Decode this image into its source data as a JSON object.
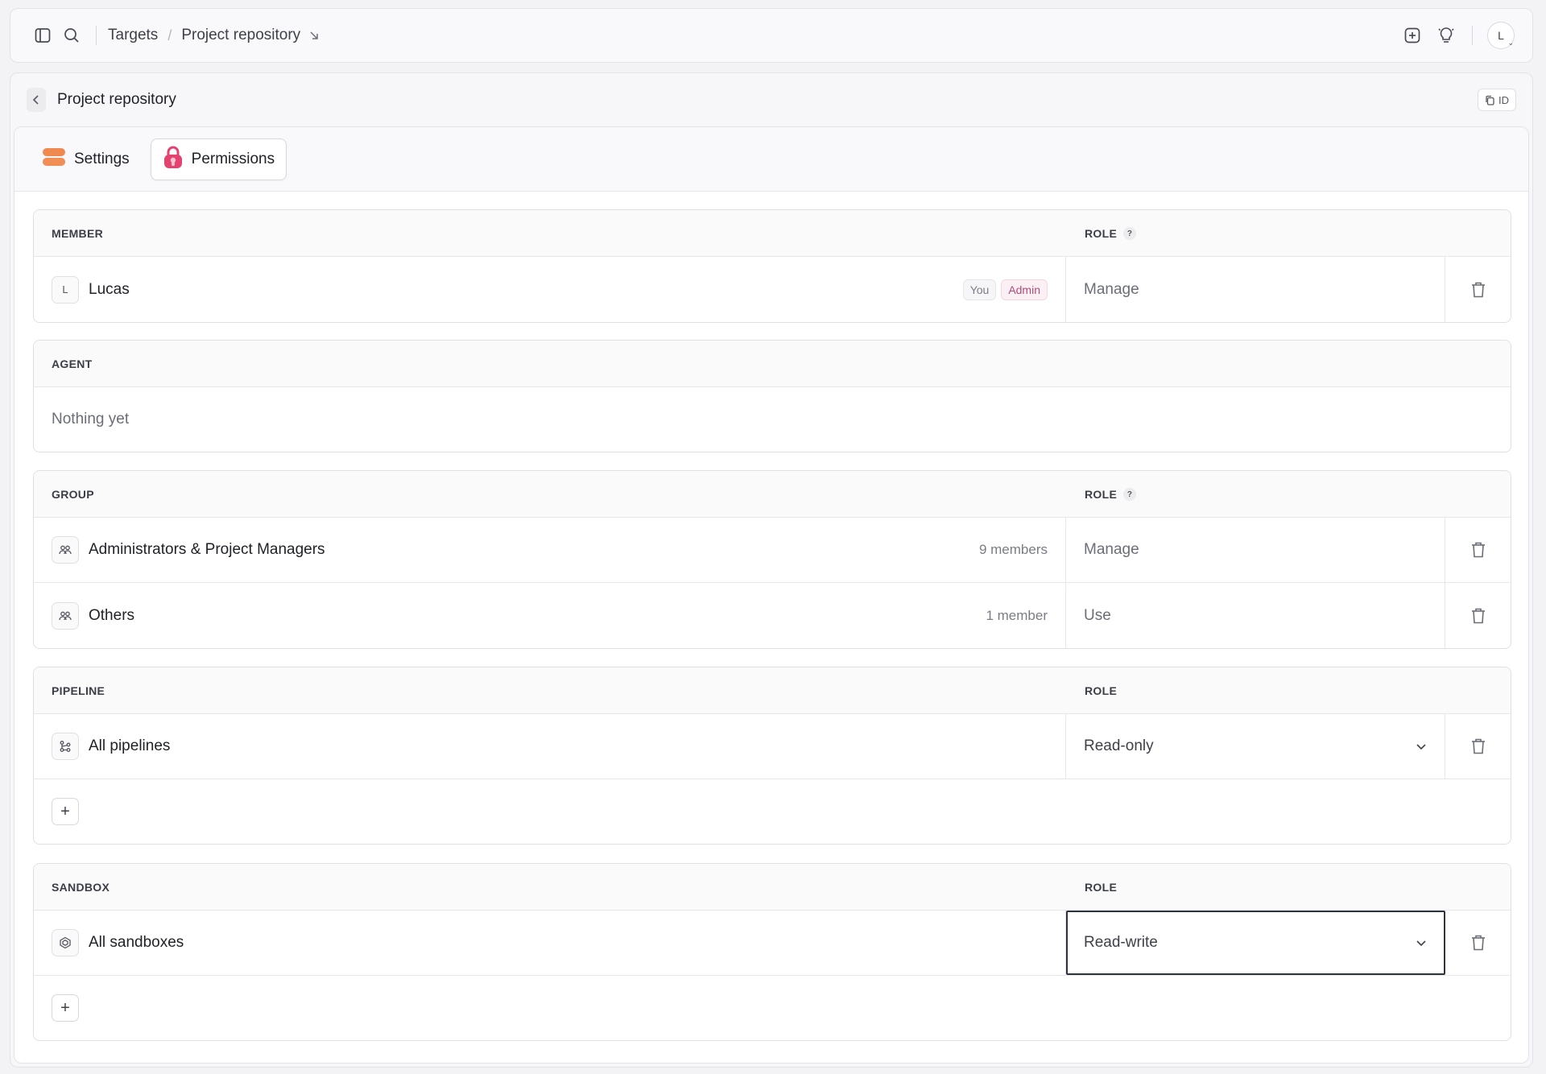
{
  "breadcrumb": {
    "first": "Targets",
    "separator": "/",
    "current": "Project repository"
  },
  "user": {
    "initial": "L"
  },
  "panel": {
    "title": "Project repository",
    "id_label": "ID"
  },
  "tabs": [
    {
      "label": "Settings",
      "active": false
    },
    {
      "label": "Permissions",
      "active": true
    }
  ],
  "sections": {
    "member": {
      "header": "MEMBER",
      "role_header": "ROLE",
      "help": "?",
      "rows": [
        {
          "initial": "L",
          "name": "Lucas",
          "badges": [
            "You",
            "Admin"
          ],
          "role": "Manage"
        }
      ]
    },
    "agent": {
      "header": "AGENT",
      "empty_text": "Nothing yet"
    },
    "group": {
      "header": "GROUP",
      "role_header": "ROLE",
      "help": "?",
      "rows": [
        {
          "name": "Administrators & Project Managers",
          "meta": "9 members",
          "role": "Manage"
        },
        {
          "name": "Others",
          "meta": "1 member",
          "role": "Use"
        }
      ]
    },
    "pipeline": {
      "header": "PIPELINE",
      "role_header": "ROLE",
      "add_label": "+",
      "rows": [
        {
          "name": "All pipelines",
          "role": "Read-only"
        }
      ]
    },
    "sandbox": {
      "header": "SANDBOX",
      "role_header": "ROLE",
      "add_label": "+",
      "rows": [
        {
          "name": "All sandboxes",
          "role": "Read-write"
        }
      ]
    }
  },
  "colors": {
    "accent_pink": "#e5436f",
    "accent_orange": "#f0894f",
    "admin_badge_text": "#b04b77"
  },
  "icons": [
    "sidebar-toggle-icon",
    "search-icon",
    "arrow-down-right-icon",
    "plus-square-icon",
    "lightbulb-icon",
    "copy-icon",
    "chevron-left-icon",
    "settings-icon",
    "lock-icon",
    "group-icon",
    "pipeline-icon",
    "sandbox-icon",
    "trash-icon",
    "chevron-down-icon"
  ]
}
